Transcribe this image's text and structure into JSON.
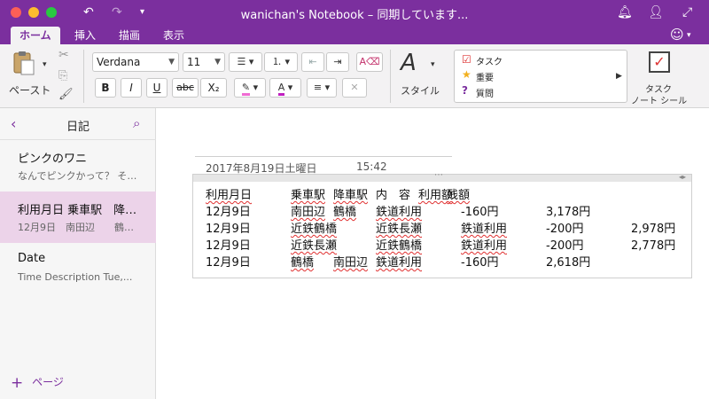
{
  "window": {
    "title": "wanichan's Notebook – 同期しています..."
  },
  "ribbon_tabs": [
    {
      "label": "ホーム",
      "active": true
    },
    {
      "label": "挿入",
      "active": false
    },
    {
      "label": "描画",
      "active": false
    },
    {
      "label": "表示",
      "active": false
    }
  ],
  "ribbon": {
    "paste_label": "ペースト",
    "font_name": "Verdana",
    "font_size": "11",
    "bold": "B",
    "italic": "I",
    "underline": "U",
    "strike": "abc",
    "subscript": "X₂",
    "highlight": "✎",
    "font_color": "A",
    "styles_label": "スタイル",
    "tags": {
      "items": [
        {
          "label": "タスク",
          "icon": "checkbox-icon"
        },
        {
          "label": "重要",
          "icon": "star-icon"
        },
        {
          "label": "質問",
          "icon": "question-icon"
        }
      ],
      "task_note_label_1": "タスク",
      "task_note_label_2": "ノート シール"
    }
  },
  "sidebar": {
    "section_title": "日記",
    "add_page_label": "ページ",
    "pages": [
      {
        "title": "ピンクのワニ",
        "subtitle": "なんでピンクかって？  そ…"
      },
      {
        "title": "利用月日  乗車駅　降…",
        "subtitle": "12月9日　南田辺　　鶴…"
      },
      {
        "title": "Date",
        "subtitle": "Time  Description  Tue,..."
      }
    ]
  },
  "note": {
    "date": "2017年8月19日土曜日",
    "time": "15:42",
    "header_row": "利用月日",
    "header_cells": [
      "利用月日",
      "乗車駅",
      "降車駅",
      "内　容",
      "利用額",
      "残額"
    ],
    "rows": [
      [
        "12月9日",
        "南田辺",
        "鶴橋",
        "鉄道利用",
        "-160円",
        "3,178円",
        ""
      ],
      [
        "12月9日",
        "近鉄鶴橋",
        "近鉄長瀬",
        "鉄道利用",
        "-200円",
        "",
        "2,978円"
      ],
      [
        "12月9日",
        "近鉄長瀬",
        "近鉄鶴橋",
        "鉄道利用",
        "-200円",
        "",
        "2,778円"
      ],
      [
        "12月9日",
        "鶴橋",
        "南田辺",
        "鉄道利用",
        "-160円",
        "2,618円",
        ""
      ]
    ]
  }
}
